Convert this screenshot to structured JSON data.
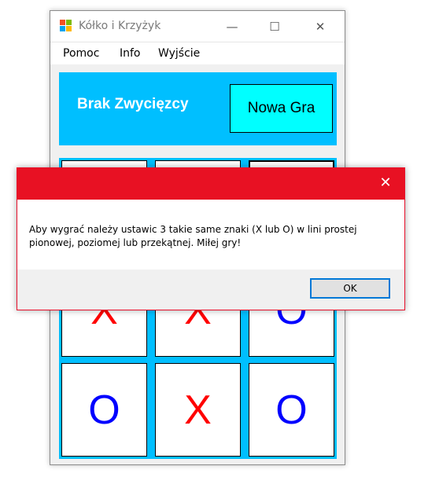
{
  "window": {
    "title": "Kółko i Krzyżyk",
    "controls": {
      "minimize": "—",
      "maximize": "☐",
      "close": "✕"
    }
  },
  "menu": {
    "items": [
      "Pomoc",
      "Info",
      "Wyjście"
    ]
  },
  "header": {
    "status": "Brak Zwycięzcy",
    "new_game_label": "Nowa Gra"
  },
  "board": {
    "cells": [
      "",
      "",
      "",
      "X",
      "X",
      "O",
      "O",
      "X",
      "O"
    ],
    "colors": {
      "X": "#ff0000",
      "O": "#0000ff"
    }
  },
  "dialog": {
    "message": "Aby wygrać należy ustawic 3 takie same znaki (X lub O) w lini prostej pionowej, poziomej lub przekątnej. Miłej gry!",
    "ok_label": "OK",
    "close_glyph": "✕"
  },
  "colors": {
    "accent": "#00bfff",
    "button": "#00ffff",
    "dialog_titlebar": "#e81123"
  }
}
